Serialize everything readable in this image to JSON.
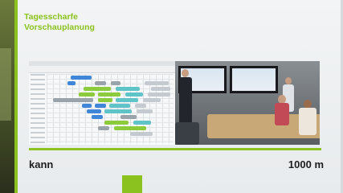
{
  "slide": {
    "title_line1": "Tagesscharfe",
    "title_line2": "Vorschauplanung"
  },
  "track": {
    "start_label": "kann",
    "end_label": "1000 m"
  },
  "colors": {
    "accent_green": "#8cc21f",
    "label_dark": "#1e1e1e",
    "planner_blue": "#3f86d8",
    "planner_green": "#8ccc3c",
    "planner_teal": "#5fc4c8",
    "planner_gray": "#9aa2aa"
  },
  "icons": {
    "photo": "meeting-room-photo",
    "planner": "planning-grid-screenshot"
  }
}
